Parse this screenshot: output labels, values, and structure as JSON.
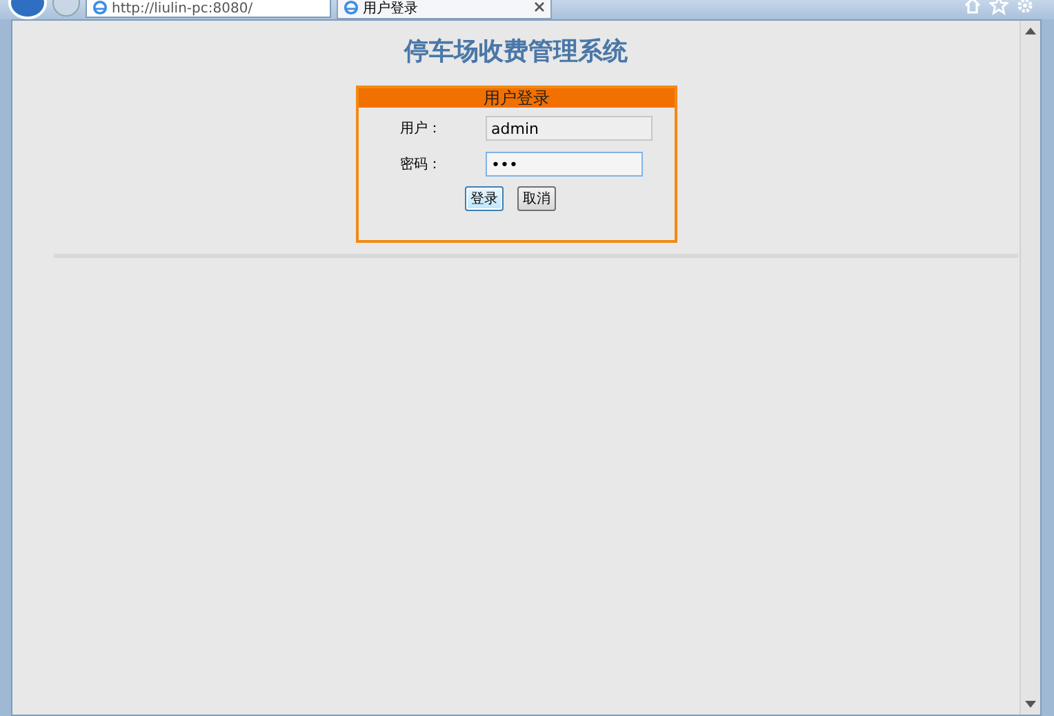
{
  "browser": {
    "address": "http://liulin-pc:8080/",
    "tabs": [
      {
        "label": "用户登录",
        "selected": true
      }
    ]
  },
  "page": {
    "title": "停车场收费管理系统",
    "login": {
      "heading": "用户登录",
      "fields": [
        {
          "label": "用户：",
          "value": "admin",
          "focused": false
        },
        {
          "label": "密码：",
          "value": "•••",
          "focused": true
        }
      ],
      "buttons": [
        {
          "label": "登录",
          "focused": true
        },
        {
          "label": "取消",
          "focused": false
        }
      ]
    }
  }
}
